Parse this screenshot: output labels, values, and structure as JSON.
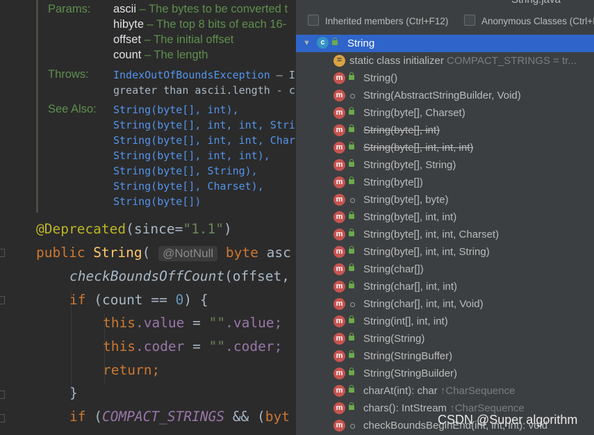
{
  "editor": {
    "doc": {
      "params_label": "Params:",
      "params": [
        {
          "name": "ascii",
          "desc": "– The bytes to be converted t"
        },
        {
          "name": "hibyte",
          "desc": "– The top 8 bits of each 16-"
        },
        {
          "name": "offset",
          "desc": "– The initial offset"
        },
        {
          "name": "count",
          "desc": "– The length"
        }
      ],
      "throws_label": "Throws:",
      "throws_link": "IndexOutOfBoundsException",
      "throws_rest": " – If",
      "throws_line2": "greater than ascii.length - cou",
      "see_also_label": "See Also:",
      "see_also": [
        "String(byte[], int),",
        "String(byte[], int, int, Stri",
        "String(byte[], int, int, Char",
        "String(byte[], int, int),",
        "String(byte[], String),",
        "String(byte[], Charset),",
        "String(byte[])"
      ]
    },
    "code": {
      "annotation": "@Deprecated",
      "ann_paren_open": "(since=",
      "ann_value": "\"1.1\"",
      "ann_paren_close": ")",
      "kw_public": "public ",
      "ctor_name": "String",
      "paren": "(",
      "inlay_hint": "@NotNull",
      "kw_byte": " byte",
      "param_tail": " asc",
      "call_name": "checkBoundsOffCount",
      "call_args": "(offset,",
      "kw_if": "if",
      "if_cond": " (count == ",
      "zero": "0",
      "if_close": ") {",
      "kw_this1": "this",
      "field_value": ".value",
      "assign1": " = ",
      "str_empty1": "\"\"",
      "dot_value": ".value;",
      "kw_this2": "this",
      "field_coder": ".coder",
      "assign2": " = ",
      "str_empty2": "\"\"",
      "dot_coder": ".coder;",
      "kw_return": "return;",
      "close_brace": "}",
      "kw_if2": "if",
      "if2_open": " (",
      "compact": "COMPACT_STRINGS",
      "if2_rest": " && (",
      "kw_byt": "byt"
    }
  },
  "popup": {
    "title": "String.java",
    "inherited_label": "Inherited members (Ctrl+F12)",
    "anonymous_label": "Anonymous Classes (Ctrl+I",
    "root": {
      "label": "String",
      "icon": "class-icon"
    },
    "items": [
      {
        "label": "static class initializer",
        "hint": " COMPACT_STRINGS = tr...",
        "icon": "static-initializer-icon",
        "vis": "none",
        "strike": false
      },
      {
        "label": "String()",
        "hint": "",
        "icon": "method-icon",
        "vis": "public",
        "strike": false
      },
      {
        "label": "String(AbstractStringBuilder, Void)",
        "hint": "",
        "icon": "method-icon",
        "vis": "package",
        "strike": false
      },
      {
        "label": "String(byte[], Charset)",
        "hint": "",
        "icon": "method-icon",
        "vis": "public",
        "strike": false
      },
      {
        "label": "String(byte[], int)",
        "hint": "",
        "icon": "method-icon",
        "vis": "public",
        "strike": true
      },
      {
        "label": "String(byte[], int, int, int)",
        "hint": "",
        "icon": "method-icon",
        "vis": "public",
        "strike": true
      },
      {
        "label": "String(byte[], String)",
        "hint": "",
        "icon": "method-icon",
        "vis": "public",
        "strike": false
      },
      {
        "label": "String(byte[])",
        "hint": "",
        "icon": "method-icon",
        "vis": "public",
        "strike": false
      },
      {
        "label": "String(byte[], byte)",
        "hint": "",
        "icon": "method-icon",
        "vis": "package",
        "strike": false
      },
      {
        "label": "String(byte[], int, int)",
        "hint": "",
        "icon": "method-icon",
        "vis": "public",
        "strike": false
      },
      {
        "label": "String(byte[], int, int, Charset)",
        "hint": "",
        "icon": "method-icon",
        "vis": "public",
        "strike": false
      },
      {
        "label": "String(byte[], int, int, String)",
        "hint": "",
        "icon": "method-icon",
        "vis": "public",
        "strike": false
      },
      {
        "label": "String(char[])",
        "hint": "",
        "icon": "method-icon",
        "vis": "public",
        "strike": false
      },
      {
        "label": "String(char[], int, int)",
        "hint": "",
        "icon": "method-icon",
        "vis": "public",
        "strike": false
      },
      {
        "label": "String(char[], int, int, Void)",
        "hint": "",
        "icon": "method-icon",
        "vis": "package",
        "strike": false
      },
      {
        "label": "String(int[], int, int)",
        "hint": "",
        "icon": "method-icon",
        "vis": "public",
        "strike": false
      },
      {
        "label": "String(String)",
        "hint": "",
        "icon": "method-icon",
        "vis": "public",
        "strike": false
      },
      {
        "label": "String(StringBuffer)",
        "hint": "",
        "icon": "method-icon",
        "vis": "public",
        "strike": false
      },
      {
        "label": "String(StringBuilder)",
        "hint": "",
        "icon": "method-icon",
        "vis": "public",
        "strike": false
      },
      {
        "label": "charAt(int): char",
        "hint": " ↑CharSequence",
        "icon": "method-icon",
        "vis": "public",
        "strike": false
      },
      {
        "label": "chars(): IntStream",
        "hint": " ↑CharSequence",
        "icon": "method-icon",
        "vis": "public",
        "strike": false
      },
      {
        "label": "checkBoundsBeginEnd(int, int, int): void",
        "hint": "",
        "icon": "method-icon",
        "vis": "package",
        "strike": false
      }
    ]
  },
  "watermark": "CSDN @Super algorithm"
}
